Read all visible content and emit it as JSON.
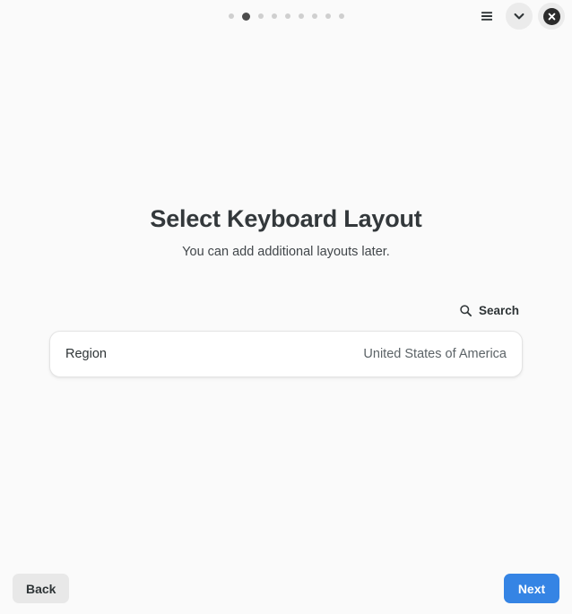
{
  "window": {
    "background_color": "#fafafa"
  },
  "header": {
    "progress": {
      "total_steps": 9,
      "current_step": 2,
      "dot_color": "#cfcfcf",
      "active_dot_color": "#4c4c4c"
    },
    "buttons": [
      {
        "name": "menu-button",
        "icon": "hamburger-menu-icon",
        "label": ""
      },
      {
        "name": "dropdown-button",
        "icon": "chevron-down-icon",
        "label": ""
      },
      {
        "name": "close-button",
        "icon": "close-circle-icon",
        "label": ""
      }
    ]
  },
  "main": {
    "title": "Select Keyboard Layout",
    "subtitle": "You can add additional layouts later.",
    "search": {
      "label": "Search",
      "icon": "search-icon"
    },
    "rows": [
      {
        "label": "Region",
        "value": "United States of America"
      }
    ]
  },
  "footer": {
    "back_label": "Back",
    "next_label": "Next",
    "next_color": "#3584e4",
    "back_color": "#e8e8e8"
  }
}
